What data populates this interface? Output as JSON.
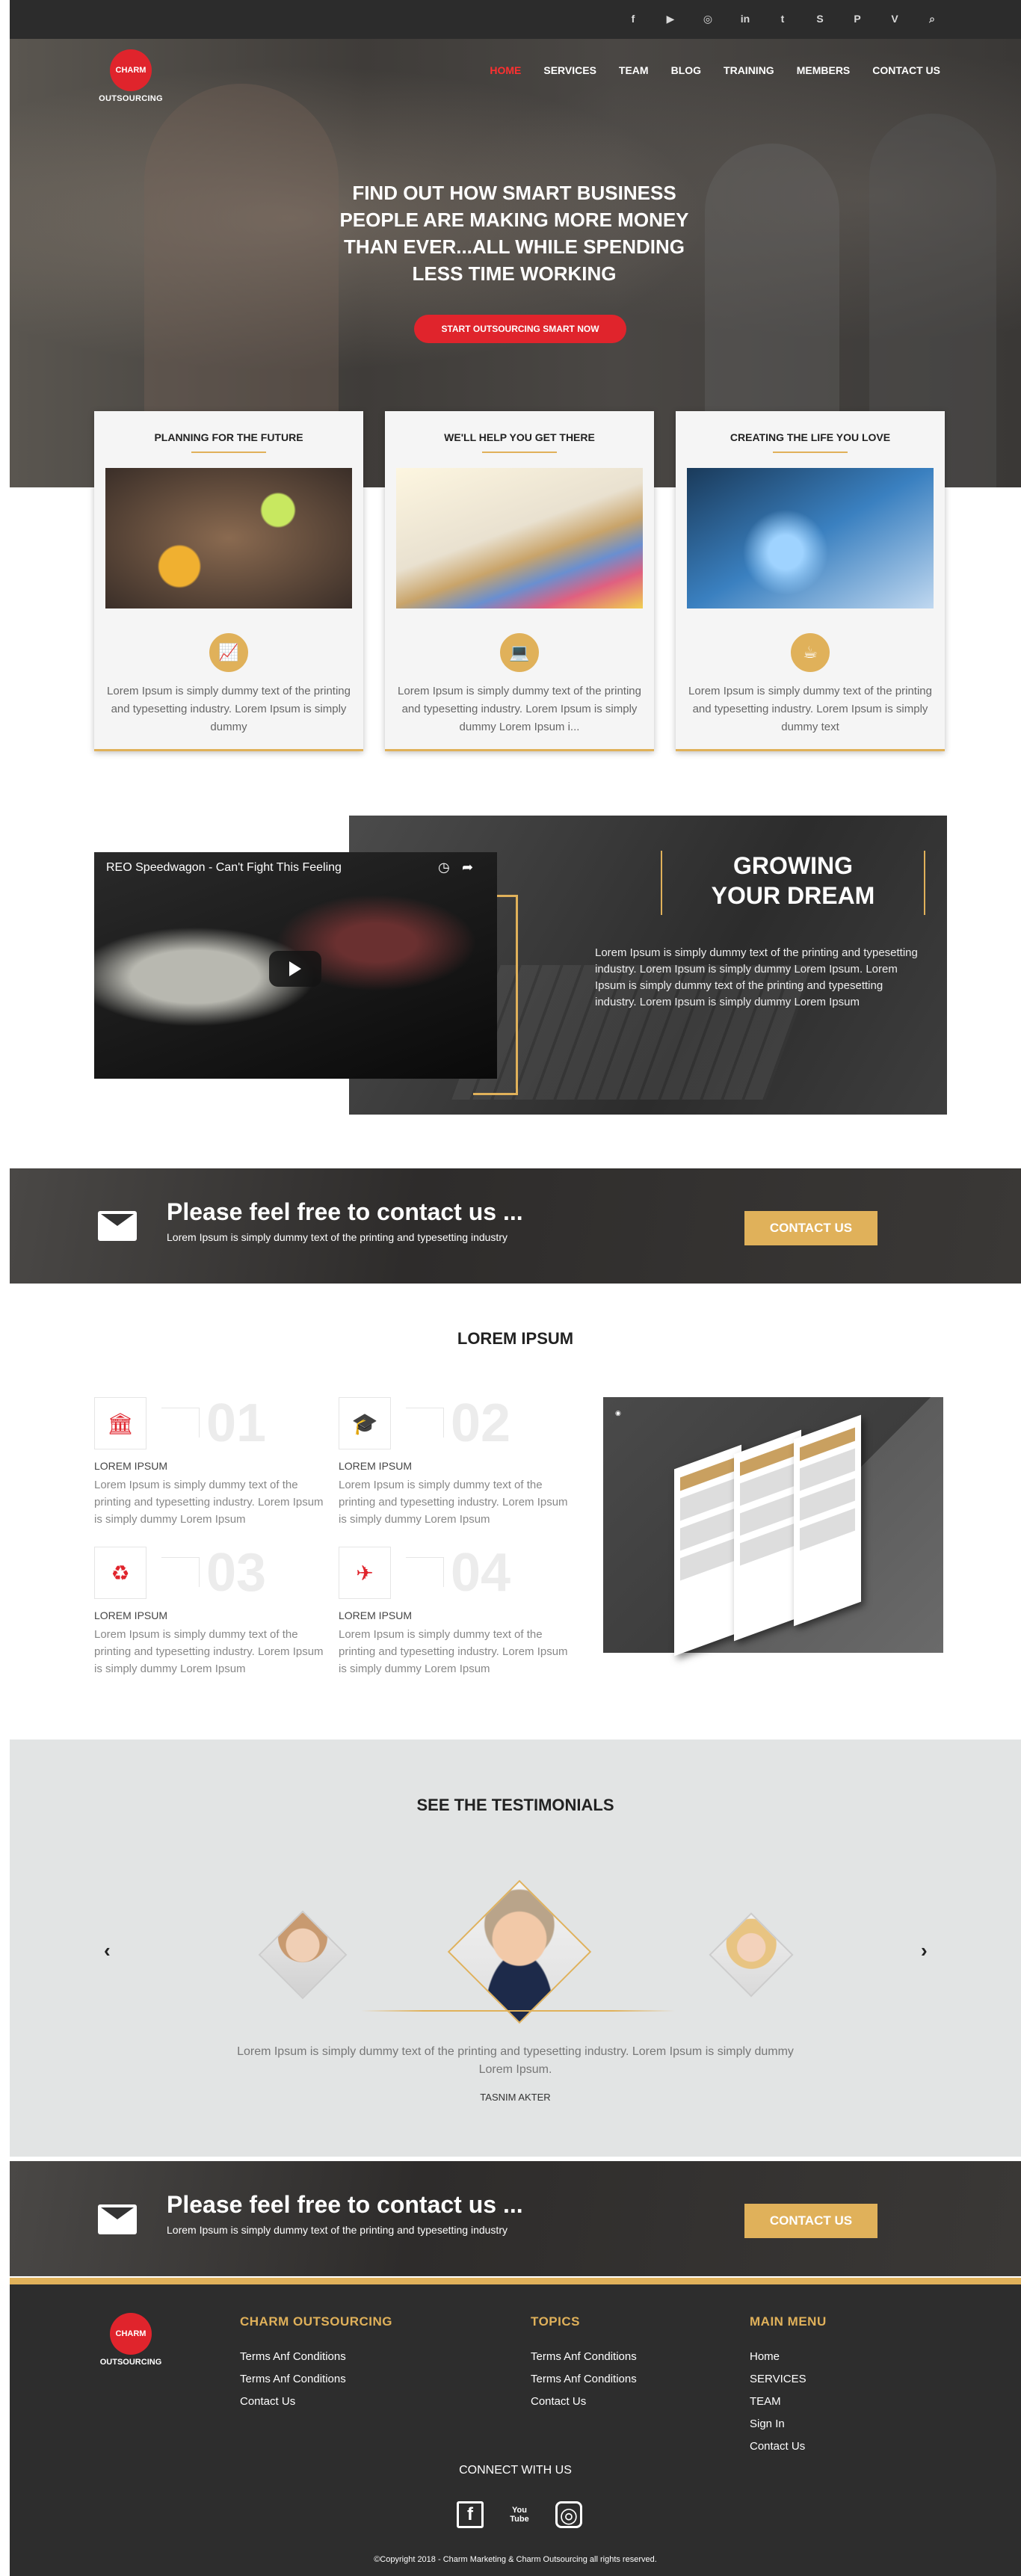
{
  "topbar": {
    "icons": [
      "f",
      "▶",
      "◎",
      "in",
      "t",
      "S",
      "P",
      "V",
      "⌕"
    ],
    "icon_names": [
      "facebook-icon",
      "youtube-icon",
      "instagram-icon",
      "linkedin-icon",
      "twitter-icon",
      "skype-icon",
      "pinterest-icon",
      "vimeo-icon",
      "search-icon"
    ]
  },
  "brand": {
    "circle": "CHARM",
    "name": "OUTSOURCING"
  },
  "nav": [
    "HOME",
    "SERVICES",
    "TEAM",
    "BLOG",
    "TRAINING",
    "MEMBERS",
    "CONTACT US"
  ],
  "hero": {
    "headline": "FIND OUT HOW SMART BUSINESS PEOPLE ARE MAKING MORE MONEY THAN EVER...ALL WHILE SPENDING LESS TIME WORKING",
    "cta": "START OUTSOURCING SMART NOW"
  },
  "cards": [
    {
      "title": "PLANNING FOR THE FUTURE",
      "icon": "📈",
      "text": "Lorem Ipsum is simply dummy text of the printing and typesetting industry. Lorem Ipsum is simply dummy"
    },
    {
      "title": "WE'LL HELP YOU GET THERE",
      "icon": "💻",
      "text": "Lorem Ipsum is simply dummy text of the printing and typesetting industry. Lorem Ipsum is simply dummy Lorem Ipsum i..."
    },
    {
      "title": "CREATING THE LIFE YOU LOVE",
      "icon": "☕",
      "text": "Lorem Ipsum is simply dummy text of the printing and typesetting industry. Lorem Ipsum is simply dummy text"
    }
  ],
  "video": {
    "title": "REO Speedwagon - Can't Fight This Feeling",
    "icon_clock": "◷",
    "icon_share": "➦"
  },
  "dream": {
    "line1": "GROWING",
    "line2": "YOUR DREAM",
    "text": "Lorem Ipsum is simply dummy text of the printing and typesetting industry. Lorem Ipsum is simply dummy Lorem Ipsum. Lorem Ipsum is simply dummy text of the printing and typesetting industry. Lorem Ipsum is simply dummy Lorem Ipsum"
  },
  "contact_band": {
    "title": "Please feel free to contact us ...",
    "sub": "Lorem Ipsum is simply dummy text of the printing and typesetting industry",
    "button": "CONTACT US"
  },
  "lorem": {
    "title": "LOREM IPSUM",
    "items": [
      {
        "num": "01",
        "icon": "🏛",
        "title": "LOREM IPSUM",
        "text": "Lorem Ipsum is simply dummy text of the printing and typesetting industry. Lorem Ipsum is simply dummy Lorem Ipsum"
      },
      {
        "num": "02",
        "icon": "🎓",
        "title": "LOREM IPSUM",
        "text": "Lorem Ipsum is simply dummy text of the printing and typesetting industry. Lorem Ipsum is simply dummy Lorem Ipsum"
      },
      {
        "num": "03",
        "icon": "♻",
        "title": "LOREM IPSUM",
        "text": "Lorem Ipsum is simply dummy text of the printing and typesetting industry. Lorem Ipsum is simply dummy Lorem Ipsum"
      },
      {
        "num": "04",
        "icon": "✈",
        "title": "LOREM IPSUM",
        "text": "Lorem Ipsum is simply dummy text of the printing and typesetting industry. Lorem Ipsum is simply dummy Lorem Ipsum"
      }
    ]
  },
  "testimonials": {
    "title": "SEE THE TESTIMONIALS",
    "prev": "‹",
    "next": "›",
    "quote": "Lorem Ipsum is simply dummy text of the printing and typesetting industry. Lorem Ipsum is simply dummy Lorem Ipsum.",
    "name": "TASNIM AKTER"
  },
  "footer": {
    "col1": {
      "title": "CHARM OUTSOURCING",
      "links": [
        "Terms Anf Conditions",
        "Terms Anf Conditions",
        "Contact Us"
      ]
    },
    "col2": {
      "title": "TOPICS",
      "links": [
        "Terms Anf Conditions",
        "Terms Anf Conditions",
        "Contact Us"
      ]
    },
    "col3": {
      "title": "MAIN MENU",
      "links": [
        "Home",
        "SERVICES",
        "TEAM",
        "Sign In",
        "Contact Us"
      ]
    },
    "connect": "CONNECT WITH US",
    "social": [
      "f",
      "You Tube",
      "◎"
    ],
    "copyright": "©Copyright 2018 - Charm Marketing & Charm Outsourcing all rights reserved."
  },
  "colors": {
    "accent": "#e0b15a",
    "brand_red": "#e0242c",
    "dark": "#2d2d2d"
  }
}
